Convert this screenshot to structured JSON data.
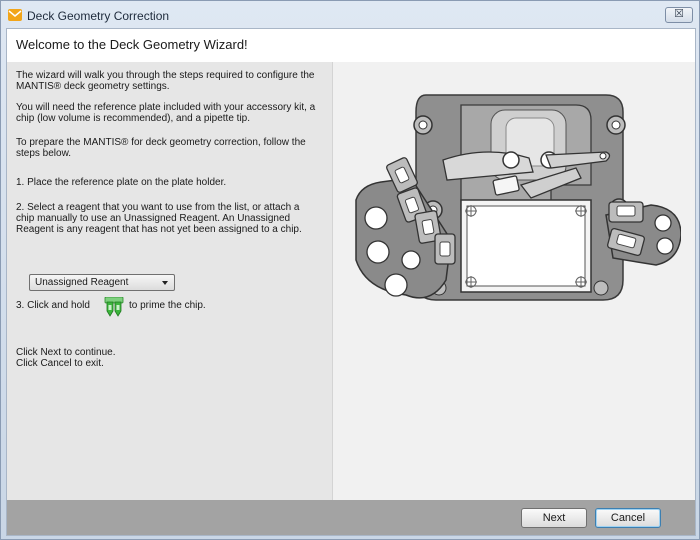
{
  "window": {
    "title": "Deck Geometry Correction",
    "close_label": "☒"
  },
  "header": {
    "title": "Welcome to the Deck Geometry Wizard!"
  },
  "instructions": {
    "p1": "The wizard will walk you through the steps required to configure the MANTIS® deck geometry settings.",
    "p2": "You will need the reference plate included with your accessory kit, a chip (low volume is recommended), and a pipette tip.",
    "p3": "To prepare the MANTIS® for deck geometry correction, follow the steps below.",
    "step1": "1. Place the reference plate on the plate holder.",
    "step2": "2. Select a reagent that you want to use from the list, or attach a chip manually to use an Unassigned Reagent. An Unassigned Reagent is any reagent that has not yet been assigned to a chip.",
    "step3_prefix": "3. Click and hold",
    "step3_suffix": "to prime the chip.",
    "continue": "Click Next to continue.",
    "exit": "Click Cancel to exit."
  },
  "reagent_select": {
    "selected": "Unassigned Reagent"
  },
  "buttons": {
    "next": "Next",
    "cancel": "Cancel"
  },
  "icons": {
    "app": "mail-icon",
    "chip": "prime-chip-icon",
    "illustration": "deck-illustration"
  },
  "colors": {
    "accent": "#f2a51a",
    "chip_green": "#3db53d",
    "footer": "#a3a3a3"
  }
}
